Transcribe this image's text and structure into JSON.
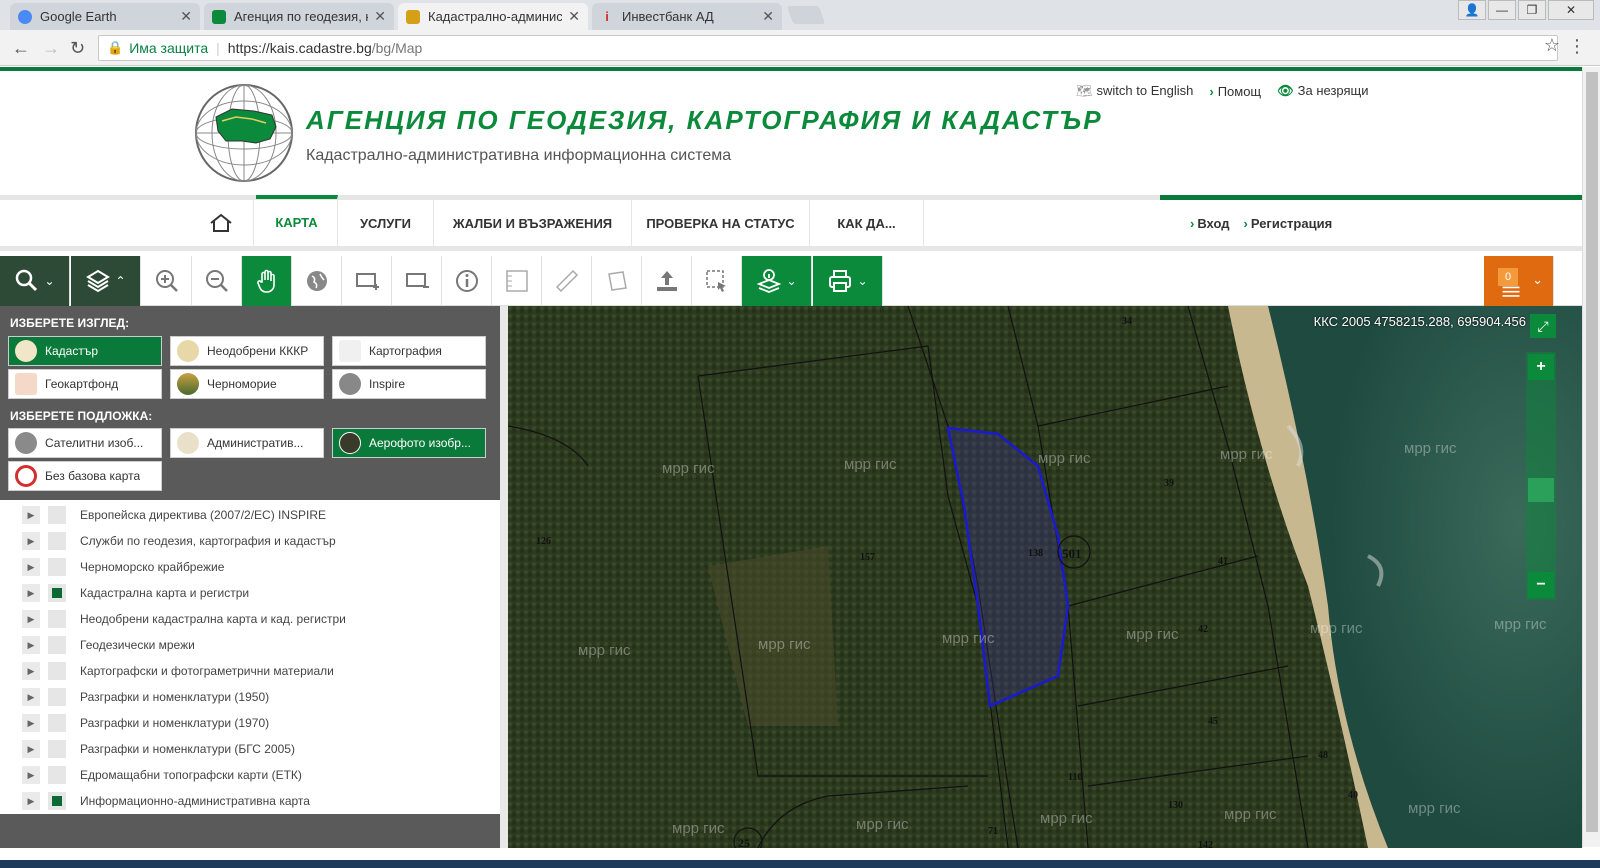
{
  "browser": {
    "tabs": [
      {
        "label": "Google Earth",
        "color": "#4a8af4",
        "active": false
      },
      {
        "label": "Агенция по геодезия, ка",
        "color": "#0a8a3a",
        "active": false
      },
      {
        "label": "Кадастрално-администр",
        "color": "#d4a017",
        "active": true
      },
      {
        "label": "Инвестбанк АД",
        "color": "#d32f2f",
        "active": false
      }
    ],
    "secure_label": "Има защита",
    "url_host": "https://kais.cadastre.bg",
    "url_path": "/bg/Map"
  },
  "header": {
    "title": "АГЕНЦИЯ ПО ГЕОДЕЗИЯ, КАРТОГРАФИЯ И КАДАСТЪР",
    "subtitle": "Кадастрално-административна информационна система",
    "links": [
      "switch to English",
      "Помощ",
      "За незрящи"
    ]
  },
  "nav": {
    "items": [
      "КАРТА",
      "УСЛУГИ",
      "ЖАЛБИ И ВЪЗРАЖЕНИЯ",
      "ПРОВЕРКА НА СТАТУС",
      "КАК ДА..."
    ],
    "login": "Вход",
    "register": "Регистрация"
  },
  "toolbar": {
    "badge_count": "0"
  },
  "panel": {
    "view_label": "ИЗБЕРЕТЕ ИЗГЛЕД:",
    "base_label": "ИЗБЕРЕТЕ ПОДЛОЖКА:",
    "views": [
      "Кадастър",
      "Неодобрени КККР",
      "Картография",
      "Геокартфонд",
      "Черноморие",
      "Inspire"
    ],
    "bases": [
      "Сателитни изоб...",
      "Административ...",
      "Аерофото изобр...",
      "Без базова карта"
    ],
    "layers": [
      {
        "name": "Европейска директива (2007/2/EC) INSPIRE",
        "checked": false
      },
      {
        "name": "Служби по геодезия, картография и кадастър",
        "checked": false
      },
      {
        "name": "Черноморско крайбрежие",
        "checked": false
      },
      {
        "name": "Кадастрална карта и регистри",
        "checked": true
      },
      {
        "name": "Неодобрени кадастрална карта и кад. регистри",
        "checked": false
      },
      {
        "name": "Геодезически мрежи",
        "checked": false
      },
      {
        "name": "Картографски и фотограметрични материали",
        "checked": false
      },
      {
        "name": "Разграфки и номенклатури (1950)",
        "checked": false
      },
      {
        "name": "Разграфки и номенклатури (1970)",
        "checked": false
      },
      {
        "name": "Разграфки и номенклатури (БГС 2005)",
        "checked": false
      },
      {
        "name": "Едромащабни топографски карти (ЕТК)",
        "checked": false
      },
      {
        "name": "Информационно-административна карта",
        "checked": true
      }
    ]
  },
  "map": {
    "coords": "ККС 2005 4758215.288, 695904.456",
    "watermark": "мрр гис",
    "parcels": [
      "34",
      "39",
      "41",
      "42",
      "45",
      "48",
      "40",
      "126",
      "157",
      "138",
      "501",
      "110",
      "130",
      "142",
      "25",
      "71"
    ]
  }
}
